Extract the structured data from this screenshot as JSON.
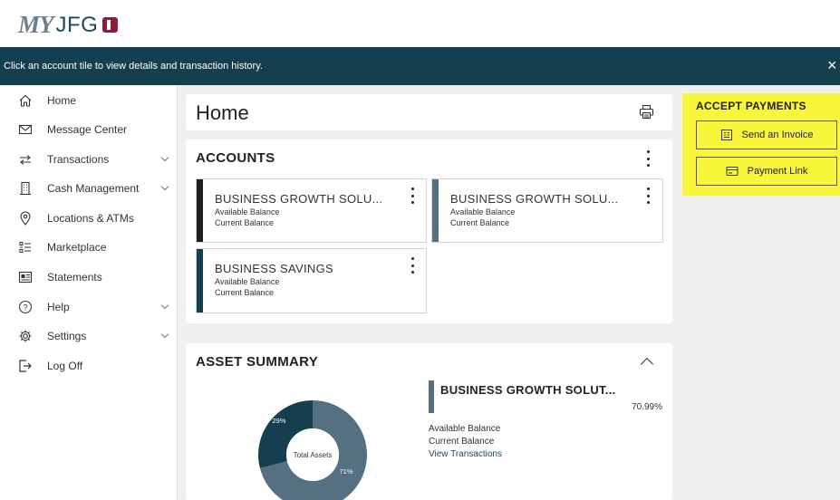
{
  "brand": {
    "my": "MY",
    "name": "JFG"
  },
  "banner": {
    "message": "Click an account tile to view details and transaction history.",
    "close": "×"
  },
  "sidebar": {
    "items": [
      {
        "label": "Home",
        "icon": "home-icon",
        "expandable": false
      },
      {
        "label": "Message Center",
        "icon": "envelope-icon",
        "expandable": false
      },
      {
        "label": "Transactions",
        "icon": "transfer-arrows-icon",
        "expandable": true
      },
      {
        "label": "Cash Management",
        "icon": "building-icon",
        "expandable": true
      },
      {
        "label": "Locations & ATMs",
        "icon": "location-pin-icon",
        "expandable": false
      },
      {
        "label": "Marketplace",
        "icon": "list-icon",
        "expandable": false
      },
      {
        "label": "Statements",
        "icon": "statement-icon",
        "expandable": false
      },
      {
        "label": "Help",
        "icon": "help-icon",
        "expandable": true
      },
      {
        "label": "Settings",
        "icon": "gear-icon",
        "expandable": true
      },
      {
        "label": "Log Off",
        "icon": "logout-icon",
        "expandable": false
      }
    ]
  },
  "home": {
    "title": "Home"
  },
  "accounts": {
    "title": "ACCOUNTS",
    "tiles": [
      {
        "name": "BUSINESS GROWTH SOLU...",
        "line1": "Available Balance",
        "line2": "Current Balance",
        "color": "#1f1f1f"
      },
      {
        "name": "BUSINESS GROWTH SOLU...",
        "line1": "Available Balance",
        "line2": "Current Balance",
        "color": "#557080"
      },
      {
        "name": "BUSINESS SAVINGS",
        "line1": "Available Balance",
        "line2": "Current Balance",
        "color": "#153f4e"
      }
    ]
  },
  "asset_summary": {
    "title": "ASSET SUMMARY",
    "donut": {
      "center_label": "Total Assets",
      "slices": [
        {
          "label": "29%",
          "value": 29,
          "color": "#153f4e"
        },
        {
          "label": "71%",
          "value": 71,
          "color": "#557080"
        }
      ]
    },
    "detail": {
      "account": "BUSINESS GROWTH SOLUT...",
      "percent": "70.99%",
      "line1": "Available Balance",
      "line2": "Current Balance",
      "link": "View Transactions",
      "color": "#557080"
    }
  },
  "accept_payments": {
    "title": "ACCEPT PAYMENTS",
    "buttons": [
      {
        "label": "Send an Invoice",
        "icon": "invoice-icon"
      },
      {
        "label": "Payment Link",
        "icon": "card-icon"
      }
    ]
  },
  "colors": {
    "banner": "#153f4e",
    "accent_yellow": "#f8f63a",
    "slate": "#557080"
  }
}
